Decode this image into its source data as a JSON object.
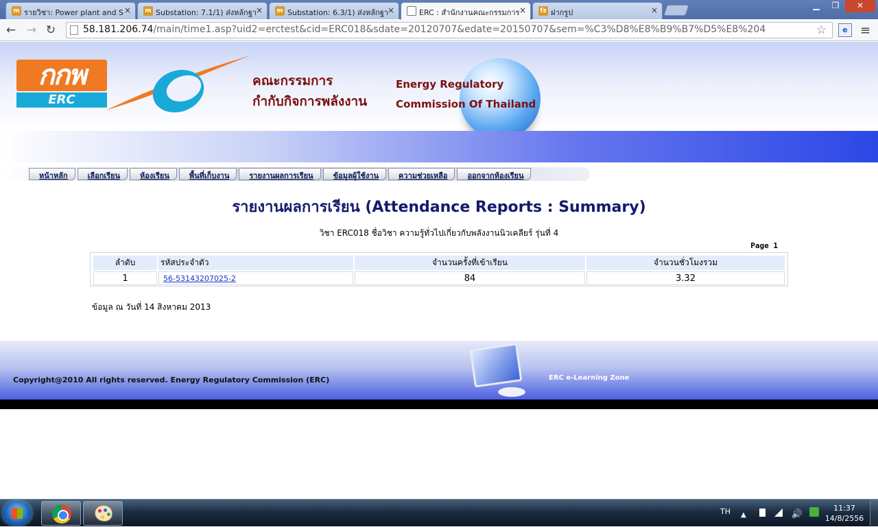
{
  "browser": {
    "tabs": [
      {
        "title": "รายวิชา: Power plant and S",
        "active": false
      },
      {
        "title": "Substation: 7.1/1) ส่งหลักฐา",
        "active": false
      },
      {
        "title": "Substation: 6.3/1) ส่งหลักฐา",
        "active": false
      },
      {
        "title": "ERC : สำนักงานคณะกรรมการ",
        "active": true
      },
      {
        "title": "ฝากรูป",
        "active": false
      }
    ],
    "tab_close": "×",
    "window_controls": {
      "minimize": "▁",
      "restore": "❐",
      "close": "✕"
    },
    "url": {
      "host": "58.181.206.74",
      "path": "/main/time1.asp?uid2=erctest&cid=ERC018&sdate=20120707&edate=20150707&sem=%C3%D8%E8%B9%B7%D5%E8%204"
    },
    "nav": {
      "back": "←",
      "forward": "→",
      "reload": "↻",
      "star": "☆",
      "menu": "≡",
      "ext": "e"
    }
  },
  "header": {
    "logo_top": "กกพ",
    "logo_bottom": "ERC",
    "org_th_line1": "คณะกรรมการ",
    "org_th_line2": "กำกับกิจการพลังงาน",
    "org_en_line1": "Energy Regulatory",
    "org_en_line2": "Commission Of Thailand"
  },
  "nav_menu": [
    "หน้าหลัก",
    "เลือกเรียน",
    "ห้องเรียน",
    "พื้นที่เก็บงาน",
    "รายงานผลการเรียน",
    "ข้อมูลผู้ใช้งาน",
    "ความช่วยเหลือ",
    "ออกจากห้องเรียน"
  ],
  "report": {
    "title": "รายงานผลการเรียน (Attendance Reports : Summary)",
    "subject": "วิชา ERC018 ชื่อวิชา ความรู้ทั่วไปเกี่ยวกับพลังงานนิวเคลียร์   รุ่นที่ 4",
    "page_label": "Page  1",
    "columns": [
      "ลำดับ",
      "รหัสประจำตัว",
      "จำนวนครั้งที่เข้าเรียน",
      "จำนวนชั่วโมงรวม"
    ],
    "rows": [
      {
        "no": "1",
        "id": "56-53143207025-2",
        "visits": "84",
        "hours": "3.32"
      }
    ],
    "data_date": "ข้อมูล ณ วันที่  14  สิงหาคม  2013"
  },
  "footer": {
    "copyright": "Copyright@2010  All  rights  reserved.  Energy  Regulatory  Commission  (ERC)",
    "elearning": "ERC e-Learning Zone"
  },
  "taskbar": {
    "language": "TH",
    "time": "11:37",
    "date": "14/8/2556"
  }
}
